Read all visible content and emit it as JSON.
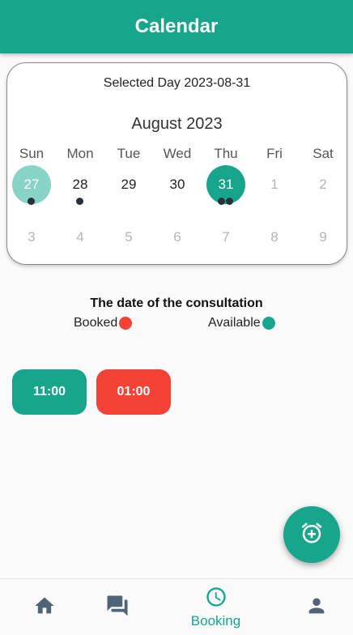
{
  "appbar": {
    "title": "Calendar"
  },
  "calendar": {
    "selected_day_text": "Selected Day 2023-08-31",
    "month_title": "August 2023",
    "weekdays": [
      "Sun",
      "Mon",
      "Tue",
      "Wed",
      "Thu",
      "Fri",
      "Sat"
    ],
    "week1": [
      "27",
      "28",
      "29",
      "30",
      "31",
      "1",
      "2"
    ],
    "week2": [
      "3",
      "4",
      "5",
      "6",
      "7",
      "8",
      "9"
    ],
    "today": "27",
    "selected": "31"
  },
  "consultation": {
    "title": "The date of the consultation",
    "legend_booked": "Booked",
    "legend_available": "Available"
  },
  "slots": [
    {
      "time": "11:00",
      "status": "available"
    },
    {
      "time": "01:00",
      "status": "booked"
    }
  ],
  "colors": {
    "primary": "#17a68c",
    "booked": "#f44336",
    "today": "#87d3c5",
    "marker": "#263238"
  },
  "fab": {
    "icon": "add-alarm-icon"
  },
  "bottom_nav": {
    "items": [
      {
        "icon": "home-icon",
        "label": ""
      },
      {
        "icon": "chat-icon",
        "label": ""
      },
      {
        "icon": "clock-icon",
        "label": "Booking"
      },
      {
        "icon": "person-icon",
        "label": ""
      }
    ]
  }
}
